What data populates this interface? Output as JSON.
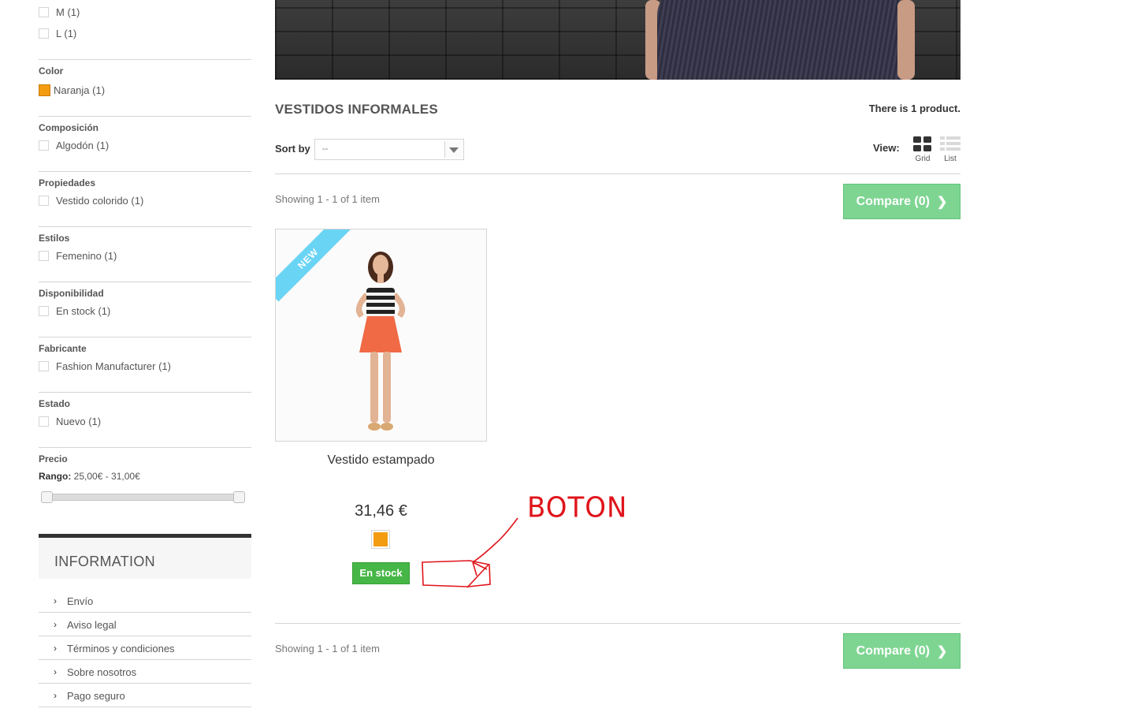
{
  "filters": {
    "sizes": [
      {
        "label": "M (1)"
      },
      {
        "label": "L (1)"
      }
    ],
    "color": {
      "title": "Color",
      "option": "Naranja (1)",
      "swatch": "#f39c11"
    },
    "composicion": {
      "title": "Composición",
      "option": "Algodón (1)"
    },
    "propiedades": {
      "title": "Propiedades",
      "option": "Vestido colorido (1)"
    },
    "estilos": {
      "title": "Estilos",
      "option": "Femenino (1)"
    },
    "disponibilidad": {
      "title": "Disponibilidad",
      "option": "En stock (1)"
    },
    "fabricante": {
      "title": "Fabricante",
      "option": "Fashion Manufacturer (1)"
    },
    "estado": {
      "title": "Estado",
      "option": "Nuevo (1)"
    },
    "precio": {
      "title": "Precio",
      "range_label": "Rango:",
      "range_value": "25,00€ - 31,00€"
    }
  },
  "information": {
    "title": "INFORMATION",
    "items": [
      "Envío",
      "Aviso legal",
      "Términos y condiciones",
      "Sobre nosotros",
      "Pago seguro"
    ]
  },
  "category": {
    "title": "VESTIDOS INFORMALES",
    "count": "There is 1 product."
  },
  "toolbar": {
    "sort_label": "Sort by",
    "sort_value": "--",
    "view_label": "View:",
    "grid_label": "Grid",
    "list_label": "List",
    "showing": "Showing 1 - 1 of 1 item",
    "compare_label": "Compare (0)"
  },
  "product": {
    "badge": "NEW",
    "name": "Vestido estampado",
    "price": "31,46 €",
    "swatch": "#f39c11",
    "availability": "En stock"
  },
  "annotation": {
    "text": "BOTON",
    "color": "#e0141b"
  },
  "colors": {
    "compare": "#7ed592",
    "stock": "#46b646",
    "ribbon": "#6ad4f5"
  }
}
